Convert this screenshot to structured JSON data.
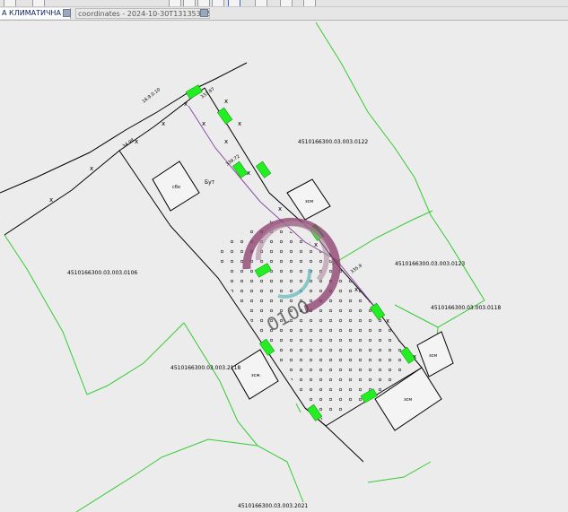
{
  "tabs": [
    {
      "label": "A КЛИМАТИЧНА 3",
      "active": true
    },
    {
      "label": "coordinates - 2024-10-30T131353.758",
      "active": false
    }
  ],
  "parcels": {
    "p0122": "4510166300.03.003.0122",
    "p0106": "4510166300.03.003.0106",
    "p0123": "4510166300.03.003.0123",
    "p0118": "4510166300.03.003.0118",
    "p2118": "4510166300.03.003.2118",
    "p2021": "4510166300.03.003.2021"
  },
  "building_labels": {
    "b1": "сбо",
    "b2": "зсм",
    "b3": "зсж",
    "b4": "зсм",
    "b5": "зсм",
    "b6": "зсж"
  },
  "edge_labels": {
    "e1": "34.98",
    "e2": "339.72",
    "e3": "333.97",
    "e4": "335.9",
    "e5": "РД1.0"
  },
  "point_label": "Бут",
  "dim_label": "16.9.0.10",
  "watermark_text": "0100",
  "colors": {
    "parcel_line": "#33cc33",
    "base_line": "#000000",
    "highlight": "#22ee22",
    "plot_line": "#8a4fa0",
    "watermark": "#8a3a6a"
  }
}
